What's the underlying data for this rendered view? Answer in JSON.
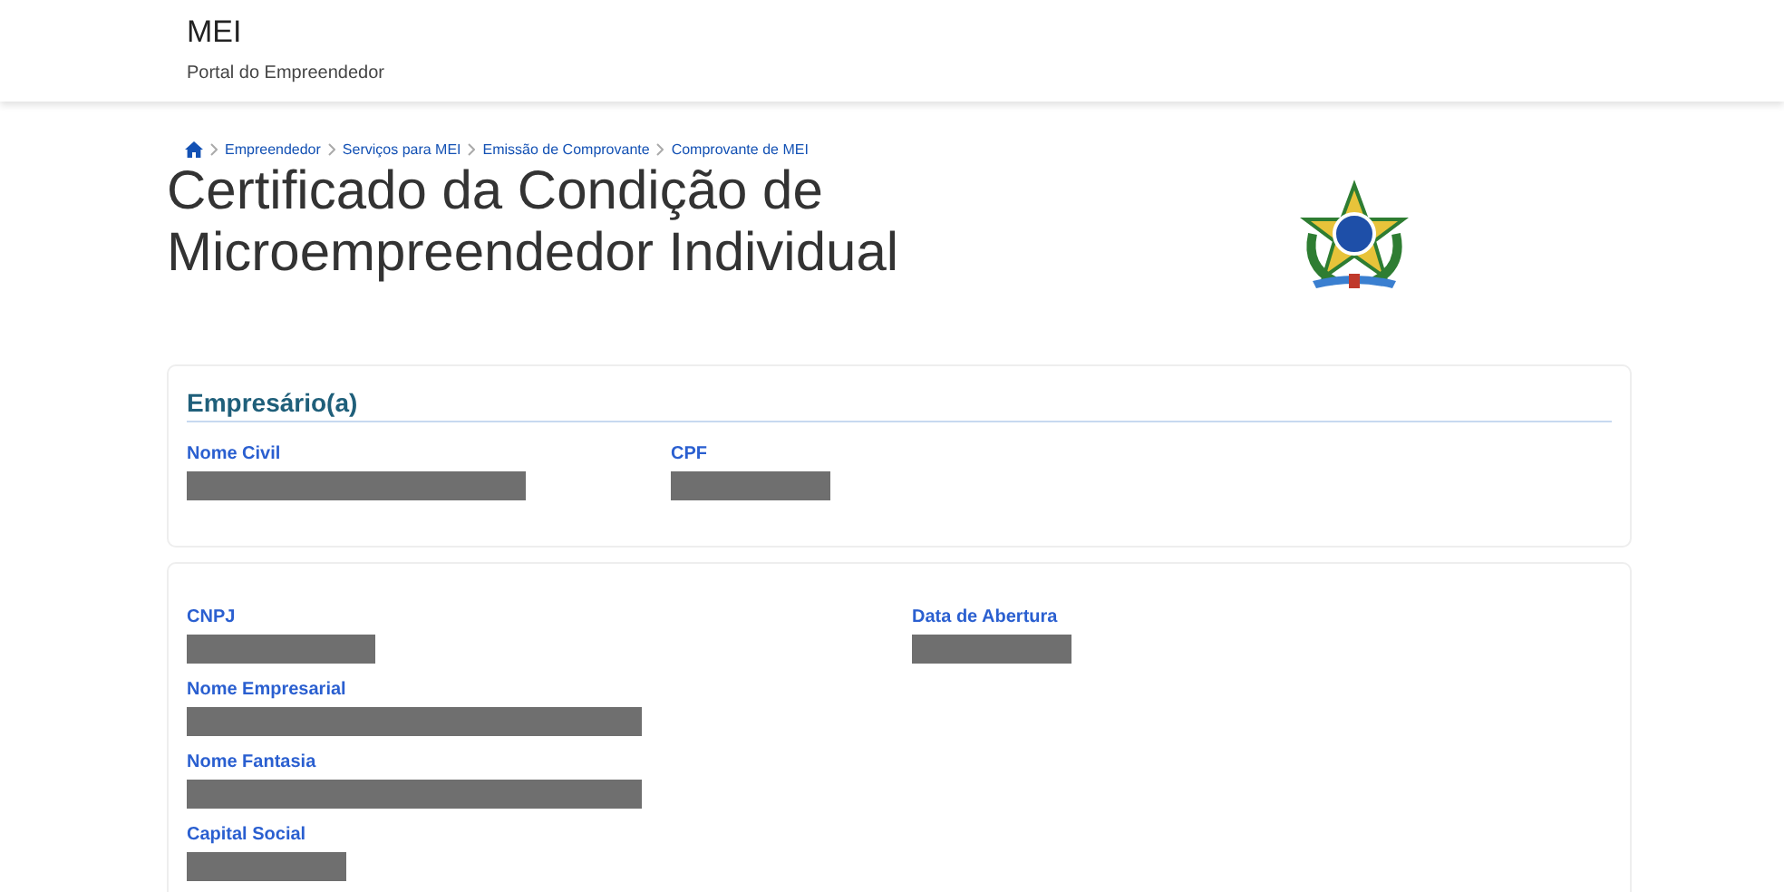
{
  "header": {
    "title": "MEI",
    "subtitle": "Portal do Empreendedor"
  },
  "breadcrumb": [
    "Empreendedor",
    "Serviços para MEI",
    "Emissão de Comprovante",
    "Comprovante de MEI"
  ],
  "page_title": [
    "Certificado da Condição de",
    "Microempreendedor Individual"
  ],
  "sections": [
    {
      "heading": "Empresário(a)",
      "columns": [
        [
          {
            "label": "Nome Civil",
            "redacted": true
          }
        ],
        [
          {
            "label": "CPF",
            "redacted": true
          }
        ]
      ]
    },
    {
      "columns": [
        [
          {
            "label": "CNPJ",
            "redacted": true
          },
          {
            "label": "Nome Empresarial",
            "redacted": true
          },
          {
            "label": "Nome Fantasia",
            "redacted": true
          },
          {
            "label": "Capital Social",
            "redacted": true
          }
        ],
        [
          {
            "label": "Data de Abertura",
            "redacted": true
          }
        ]
      ]
    }
  ]
}
